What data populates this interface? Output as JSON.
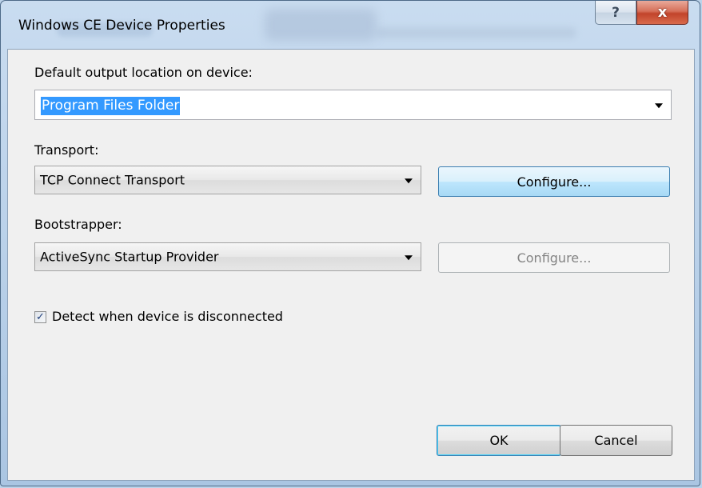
{
  "window": {
    "title": "Windows CE Device Properties",
    "help_glyph": "?",
    "close_glyph": "x"
  },
  "output_location": {
    "label": "Default output location on device:",
    "value": "Program Files Folder"
  },
  "transport": {
    "label": "Transport:",
    "value": "TCP Connect Transport",
    "configure_label": "Configure..."
  },
  "bootstrapper": {
    "label": "Bootstrapper:",
    "value": "ActiveSync Startup Provider",
    "configure_label": "Configure..."
  },
  "detect_disconnect": {
    "label": "Detect when device is disconnected",
    "checked": true
  },
  "footer": {
    "ok_label": "OK",
    "cancel_label": "Cancel"
  },
  "colors": {
    "selection": "#3399ff",
    "close_button": "#c2442b",
    "hot_button": "#bee6fd"
  },
  "icons": {
    "help": "question-mark",
    "close": "x-mark",
    "dropdown": "triangle-down",
    "check": "checkmark"
  }
}
